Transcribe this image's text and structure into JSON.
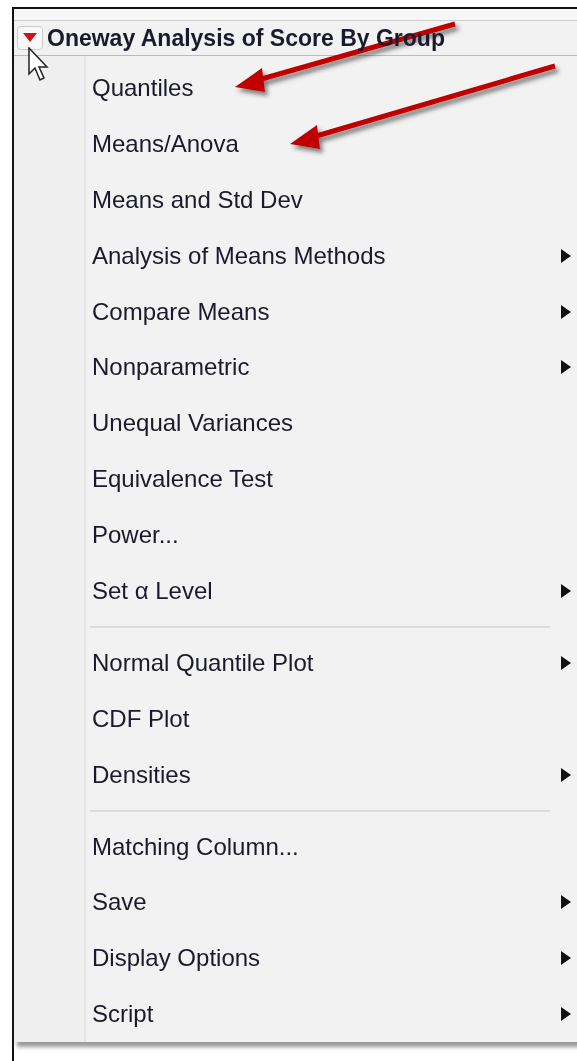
{
  "header": {
    "title": "Oneway Analysis of Score By Group",
    "menu_open": true
  },
  "menu": {
    "groups": [
      [
        {
          "label": "Quantiles",
          "submenu": false
        },
        {
          "label": "Means/Anova",
          "submenu": false
        },
        {
          "label": "Means and Std Dev",
          "submenu": false
        },
        {
          "label": "Analysis of Means Methods",
          "submenu": true
        },
        {
          "label": "Compare Means",
          "submenu": true
        },
        {
          "label": "Nonparametric",
          "submenu": true
        },
        {
          "label": "Unequal Variances",
          "submenu": false
        },
        {
          "label": "Equivalence Test",
          "submenu": false
        },
        {
          "label": "Power...",
          "submenu": false
        },
        {
          "label": "Set α Level",
          "submenu": true
        }
      ],
      [
        {
          "label": "Normal Quantile Plot",
          "submenu": true
        },
        {
          "label": "CDF Plot",
          "submenu": false
        },
        {
          "label": "Densities",
          "submenu": true
        }
      ],
      [
        {
          "label": "Matching Column...",
          "submenu": false
        },
        {
          "label": "Save",
          "submenu": true
        },
        {
          "label": "Display Options",
          "submenu": true
        },
        {
          "label": "Script",
          "submenu": true
        }
      ]
    ]
  }
}
